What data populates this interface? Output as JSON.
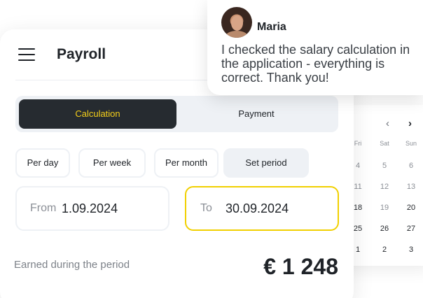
{
  "calendar": {
    "prev_icon": "chevron-left-icon",
    "next_icon": "chevron-right-icon",
    "headers": [
      "Fri",
      "Sat",
      "Sun"
    ],
    "rows": [
      [
        "4",
        "5",
        "6"
      ],
      [
        "11",
        "12",
        "13"
      ],
      [
        "18",
        "19",
        "20"
      ],
      [
        "25",
        "26",
        "27"
      ],
      [
        "1",
        "2",
        "3"
      ]
    ]
  },
  "header": {
    "menu_icon": "hamburger-menu-icon",
    "title": "Payroll"
  },
  "tabs": {
    "calculation": "Calculation",
    "payment": "Payment"
  },
  "periods": {
    "per_day": "Per day",
    "per_week": "Per week",
    "per_month": "Per month",
    "set_period": "Set period"
  },
  "dates": {
    "from_label": "From",
    "from_value": "1.09.2024",
    "to_label": "To",
    "to_value": "30.09.2024"
  },
  "summary": {
    "earned_label": "Earned during the period",
    "amount": "€ 1 248"
  },
  "chat": {
    "name": "Maria",
    "message": "I checked the salary calculation in the application - everything is correct. Thank you!"
  },
  "colors": {
    "accent_yellow": "#f1d000",
    "dark": "#262b30",
    "light_gray": "#eef1f5"
  }
}
